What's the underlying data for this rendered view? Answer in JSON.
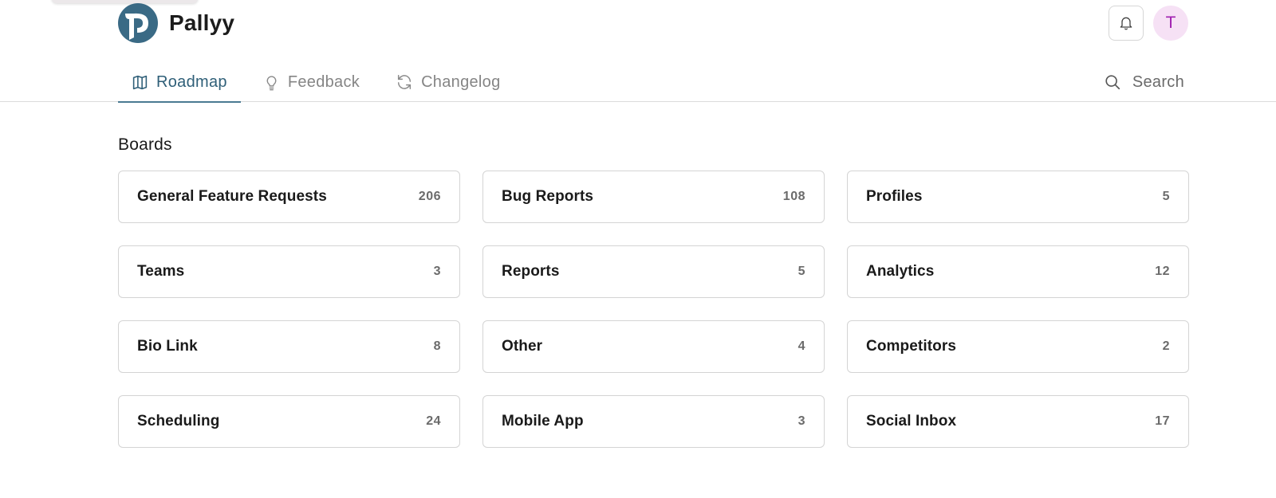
{
  "app": {
    "name": "Pallyy"
  },
  "header": {
    "notifications_icon": "bell-icon",
    "avatar_initial": "T"
  },
  "nav": {
    "tabs": [
      {
        "label": "Roadmap",
        "icon": "map-icon",
        "active": true
      },
      {
        "label": "Feedback",
        "icon": "lightbulb-icon",
        "active": false
      },
      {
        "label": "Changelog",
        "icon": "refresh-icon",
        "active": false
      }
    ],
    "search_label": "Search"
  },
  "boards": {
    "title": "Boards",
    "items": [
      {
        "name": "General Feature Requests",
        "count": "206"
      },
      {
        "name": "Bug Reports",
        "count": "108"
      },
      {
        "name": "Profiles",
        "count": "5"
      },
      {
        "name": "Teams",
        "count": "3"
      },
      {
        "name": "Reports",
        "count": "5"
      },
      {
        "name": "Analytics",
        "count": "12"
      },
      {
        "name": "Bio Link",
        "count": "8"
      },
      {
        "name": "Other",
        "count": "4"
      },
      {
        "name": "Competitors",
        "count": "2"
      },
      {
        "name": "Scheduling",
        "count": "24"
      },
      {
        "name": "Mobile App",
        "count": "3"
      },
      {
        "name": "Social Inbox",
        "count": "17"
      }
    ]
  },
  "colors": {
    "accent": "#2f5f78",
    "logo": "#3a6a85",
    "avatar_bg": "#f6e1f5",
    "avatar_text": "#a020b0"
  }
}
